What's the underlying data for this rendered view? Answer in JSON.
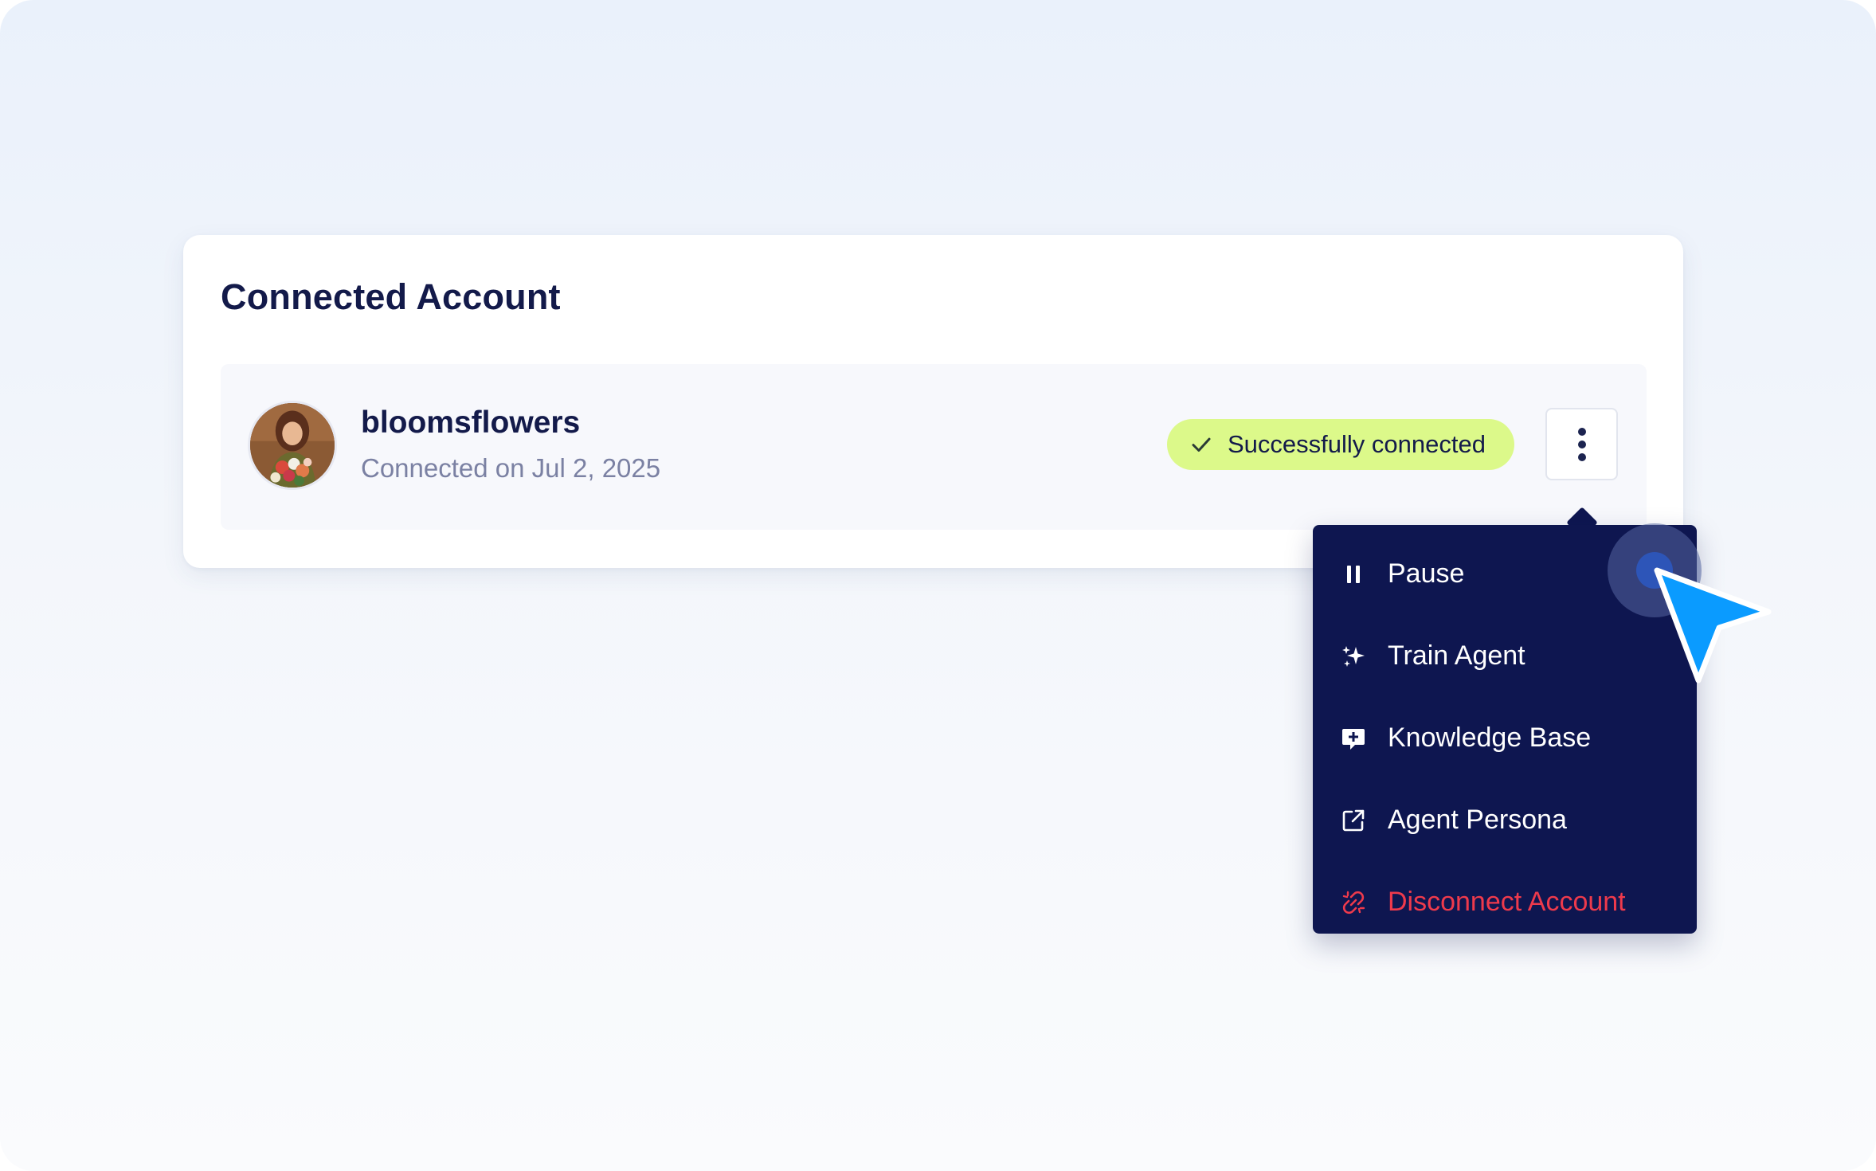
{
  "card": {
    "title": "Connected Account"
  },
  "account": {
    "username": "bloomsflowers",
    "connected_date": "Connected on Jul 2, 2025",
    "status_label": "Successfully connected",
    "status_icon": "check-icon",
    "status_color": "#dcf98a"
  },
  "actions_button": {
    "icon": "more-vertical-icon"
  },
  "menu": {
    "items": [
      {
        "label": "Pause",
        "icon": "pause-icon"
      },
      {
        "label": "Train Agent",
        "icon": "sparkles-icon"
      },
      {
        "label": "Knowledge Base",
        "icon": "chat-plus-icon"
      },
      {
        "label": "Agent Persona",
        "icon": "external-link-icon"
      },
      {
        "label": "Disconnect Account",
        "icon": "unlink-icon",
        "color": "#ee3a4c"
      }
    ],
    "background": "#0e1650"
  },
  "cursor": {
    "color": "#0a9bff"
  }
}
